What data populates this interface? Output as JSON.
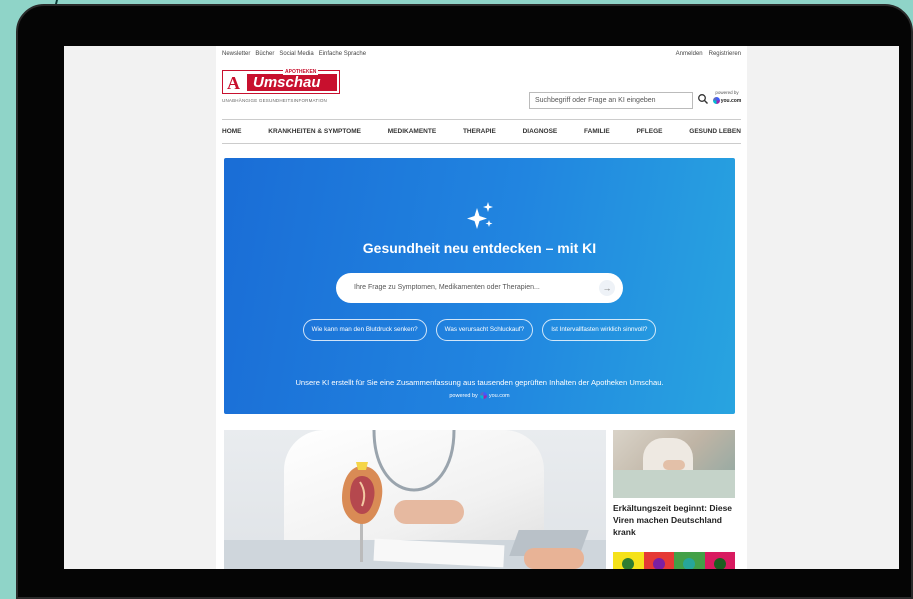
{
  "topbar": {
    "left_links": [
      "Newsletter",
      "Bücher",
      "Social Media",
      "Einfache Sprache"
    ],
    "right_links": [
      "Anmelden",
      "Registrieren"
    ]
  },
  "logo": {
    "small": "APOTHEKEN",
    "name": "Umschau",
    "tagline": "UNABHÄNGIGE GESUNDHEITSINFORMATION"
  },
  "search": {
    "placeholder": "Suchbegriff oder Frage an KI eingeben",
    "powered_label": "powered by",
    "powered_brand": "you.com"
  },
  "nav": {
    "items": [
      "HOME",
      "KRANKHEITEN & SYMPTOME",
      "MEDIKAMENTE",
      "THERAPIE",
      "DIAGNOSE",
      "FAMILIE",
      "PFLEGE",
      "GESUND LEBEN"
    ]
  },
  "hero": {
    "title": "Gesundheit neu entdecken – mit KI",
    "input_placeholder": "Ihre Frage zu Symptomen, Medikamenten oder Therapien...",
    "arrow": "→",
    "chips": [
      "Wie kann man den Blutdruck senken?",
      "Was verursacht Schluckauf?",
      "Ist Intervallfasten wirklich sinnvoll?"
    ],
    "note": "Unsere KI erstellt für Sie eine Zusammenfassung aus tausenden geprüften Inhalten der Apotheken Umschau.",
    "powered_label": "powered by",
    "powered_brand": "you.com"
  },
  "side_article": {
    "title": "Erkältungszeit beginnt: Diese Viren machen Deutschland krank"
  },
  "colors": {
    "brand_red": "#c8102e",
    "hero_blue": "#1a6dd6",
    "virus_tiles": [
      "#f5e21a",
      "#e53935",
      "#43a047",
      "#d81b60"
    ]
  }
}
